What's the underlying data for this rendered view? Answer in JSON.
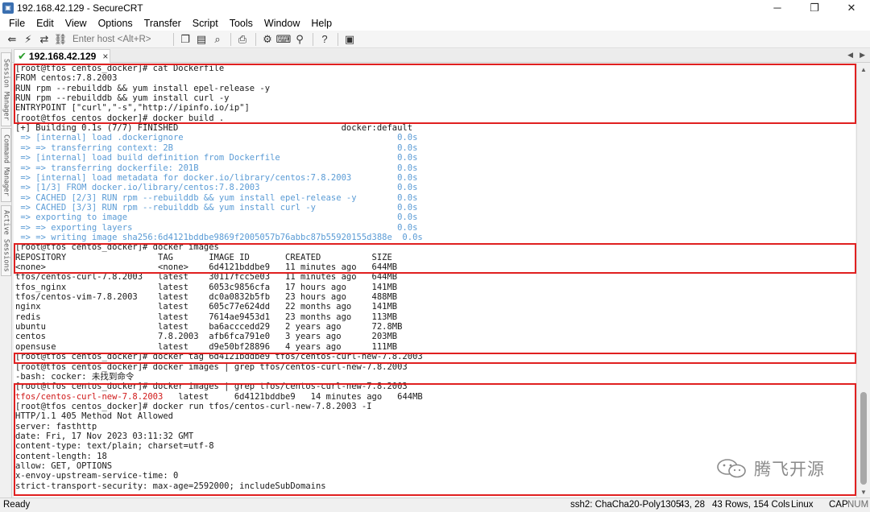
{
  "window": {
    "title": "192.168.42.129 - SecureCRT",
    "controls": {
      "minimize": "─",
      "maximize": "❐",
      "close": "✕"
    }
  },
  "menu": [
    "File",
    "Edit",
    "View",
    "Options",
    "Transfer",
    "Script",
    "Tools",
    "Window",
    "Help"
  ],
  "toolbar": {
    "host_placeholder": "Enter host <Alt+R>"
  },
  "side_tabs": [
    "Session Manager",
    "Command Manager",
    "Active Sessions"
  ],
  "tab": {
    "label": "192.168.42.129",
    "close": "×"
  },
  "terminal": {
    "lines": [
      "[root@tfos centos_docker]# cat Dockerfile",
      "FROM centos:7.8.2003",
      "RUN rpm --rebuilddb && yum install epel-release -y",
      "RUN rpm --rebuilddb && yum install curl -y",
      "ENTRYPOINT [\"curl\",\"-s\",\"http://ipinfo.io/ip\"]",
      "[root@tfos centos_docker]# docker build .",
      "[+] Building 0.1s (7/7) FINISHED                                docker:default",
      " => [internal] load .dockerignore                                          0.0s",
      " => => transferring context: 2B                                            0.0s",
      " => [internal] load build definition from Dockerfile                       0.0s",
      " => => transferring dockerfile: 201B                                       0.0s",
      " => [internal] load metadata for docker.io/library/centos:7.8.2003         0.0s",
      " => [1/3] FROM docker.io/library/centos:7.8.2003                           0.0s",
      " => CACHED [2/3] RUN rpm --rebuilddb && yum install epel-release -y        0.0s",
      " => CACHED [3/3] RUN rpm --rebuilddb && yum install curl -y                0.0s",
      " => exporting to image                                                     0.0s",
      " => => exporting layers                                                    0.0s",
      " => => writing image sha256:6d4121bddbe9869f2005057b76abbc87b55920155d388e  0.0s",
      "[root@tfos centos_docker]# docker images",
      "REPOSITORY                  TAG       IMAGE ID       CREATED          SIZE",
      "<none>                      <none>    6d4121bddbe9   11 minutes ago   644MB",
      "tfos/centos-curl-7.8.2003   latest    30117fcc5e03   11 minutes ago   644MB",
      "tfos_nginx                  latest    6053c9856cfa   17 hours ago     141MB",
      "tfos/centos-vim-7.8.2003    latest    dc0a0832b5fb   23 hours ago     488MB",
      "nginx                       latest    605c77e624dd   22 months ago    141MB",
      "redis                       latest    7614ae9453d1   23 months ago    113MB",
      "ubuntu                      latest    ba6acccedd29   2 years ago      72.8MB",
      "centos                      7.8.2003  afb6fca791e0   3 years ago      203MB",
      "opensuse                    latest    d9e50bf28896   4 years ago      111MB",
      "[root@tfos centos_docker]# docker tag 6d4121bddbe9 tfos/centos-curl-new-7.8.2003",
      "[root@tfos centos_docker]# docker images | grep tfos/centos-curl-new-7.8.2003",
      "-bash: cocker: 未找到命令",
      "[root@tfos centos_docker]# docker images | grep tfos/centos-curl-new-7.8.2003",
      "   latest     6d4121bddbe9   14 minutes ago   644MB",
      "[root@tfos centos_docker]# docker run tfos/centos-curl-new-7.8.2003 -I",
      "HTTP/1.1 405 Method Not Allowed",
      "server: fasthttp",
      "date: Fri, 17 Nov 2023 03:11:32 GMT",
      "content-type: text/plain; charset=utf-8",
      "content-length: 18",
      "allow: GET, OPTIONS",
      "x-envoy-upstream-service-time: 0",
      "strict-transport-security: max-age=2592000; includeSubDomains"
    ],
    "grep_match": "tfos/centos-curl-new-7.8.2003"
  },
  "watermark": "腾飞开源",
  "status": {
    "ready": "Ready",
    "cipher": "ssh2: ChaCha20-Poly1305",
    "position": "43, 28",
    "size": "43 Rows, 154 Cols",
    "os": "Linux",
    "caps": "CAP",
    "num": "NUM"
  }
}
